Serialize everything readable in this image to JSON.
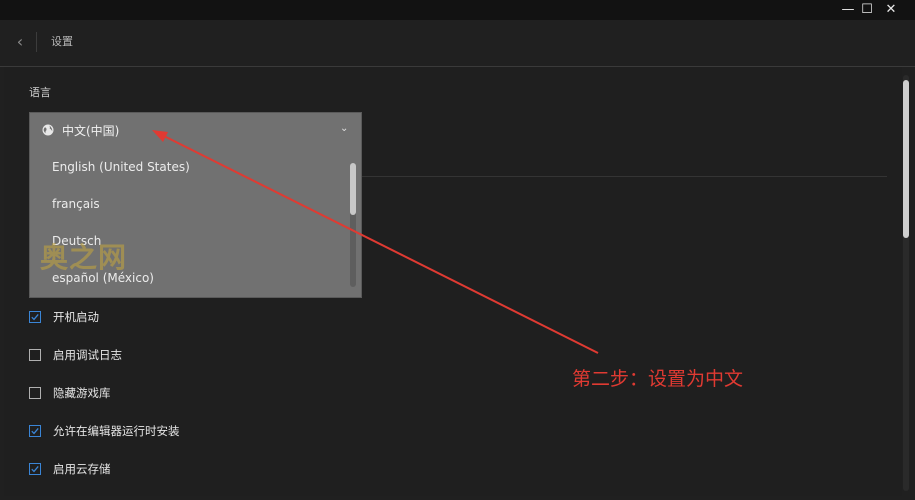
{
  "window": {
    "minimize_glyph": "—",
    "maximize_glyph": "☐",
    "close_glyph": "✕"
  },
  "header": {
    "back_glyph": "‹",
    "title": "设置"
  },
  "language": {
    "section_label": "语言",
    "selected": "中文(中国)",
    "options": [
      "English (United States)",
      "français",
      "Deutsch",
      "español (México)"
    ]
  },
  "settings": [
    {
      "label": "开机启动",
      "checked": true
    },
    {
      "label": "启用调试日志",
      "checked": false
    },
    {
      "label": "隐藏游戏库",
      "checked": false
    },
    {
      "label": "允许在编辑器运行时安装",
      "checked": true
    },
    {
      "label": "启用云存储",
      "checked": true
    }
  ],
  "watermark": "奥之网",
  "annotation": {
    "text": "第二步：设置为中文",
    "color": "#e03a32"
  },
  "colors": {
    "accent": "#3a85d6",
    "background": "#202020"
  }
}
